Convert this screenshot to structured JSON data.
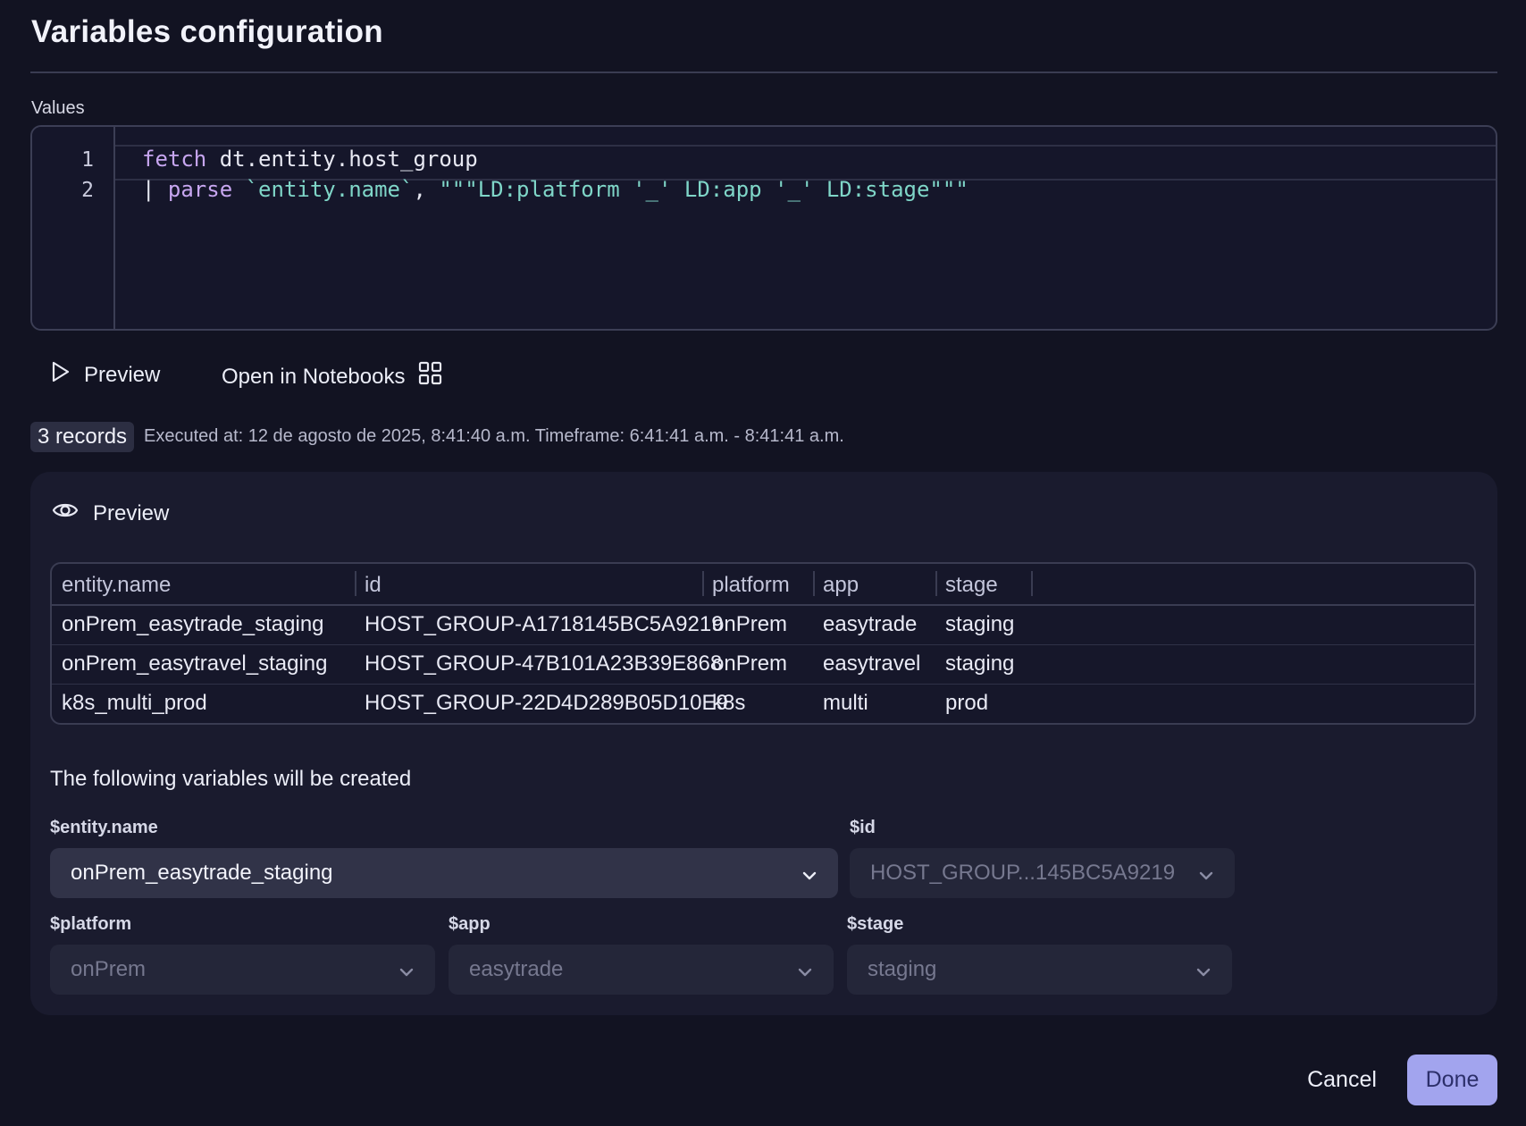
{
  "dialog": {
    "title": "Variables configuration"
  },
  "editor": {
    "label": "Values",
    "line_numbers": [
      "1",
      "2"
    ],
    "line1": {
      "keyword": "fetch",
      "rest": " dt.entity.host_group"
    },
    "line2": {
      "pipe": "| ",
      "keyword": "parse",
      "field": " `entity.name`",
      "comma": ", ",
      "pattern": "\"\"\"LD:platform '_' LD:app '_' LD:stage\"\"\""
    }
  },
  "actions": {
    "preview_label": "Preview",
    "notebooks_label": "Open in Notebooks"
  },
  "result": {
    "records_badge": "3 records",
    "executed_text": "Executed at: 12 de agosto de 2025, 8:41:40 a.m. Timeframe: 6:41:41 a.m. - 8:41:41 a.m."
  },
  "preview": {
    "heading": "Preview",
    "columns": [
      "entity.name",
      "id",
      "platform",
      "app",
      "stage"
    ],
    "rows": [
      [
        "onPrem_easytrade_staging",
        "HOST_GROUP-A1718145BC5A9219",
        "onPrem",
        "easytrade",
        "staging"
      ],
      [
        "onPrem_easytravel_staging",
        "HOST_GROUP-47B101A23B39E868",
        "onPrem",
        "easytravel",
        "staging"
      ],
      [
        "k8s_multi_prod",
        "HOST_GROUP-22D4D289B05D10E9",
        "k8s",
        "multi",
        "prod"
      ]
    ],
    "variables_heading": "The following variables will be created",
    "variables": [
      {
        "label": "$entity.name",
        "value": "onPrem_easytrade_staging"
      },
      {
        "label": "$id",
        "value": "HOST_GROUP...145BC5A9219"
      },
      {
        "label": "$platform",
        "value": "onPrem"
      },
      {
        "label": "$app",
        "value": "easytrade"
      },
      {
        "label": "$stage",
        "value": "staging"
      }
    ]
  },
  "footer": {
    "cancel_label": "Cancel",
    "done_label": "Done"
  },
  "colors": {
    "background": "#121322",
    "panel": "#1a1b2e",
    "accent": "#a2a4ee",
    "keyword": "#c7a6f0",
    "string": "#7fd6c8"
  },
  "icons": [
    "play-icon",
    "grid-icon",
    "eye-icon",
    "chevron-down-icon"
  ]
}
